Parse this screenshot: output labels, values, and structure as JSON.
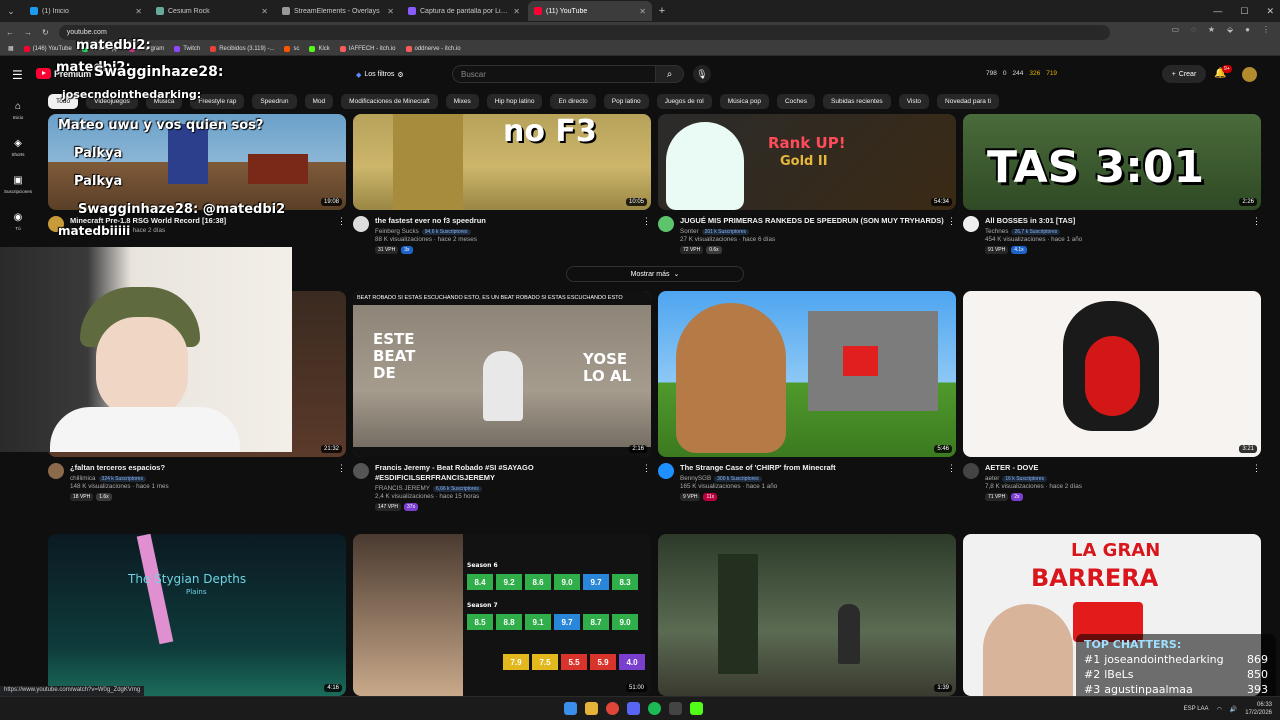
{
  "browser": {
    "tabs": [
      {
        "label": "(1) Inicio",
        "fav": "#1d9bf0",
        "active": false
      },
      {
        "label": "Cesium Rock",
        "fav": "#6a9",
        "active": false
      },
      {
        "label": "StreamElements - Overlays",
        "fav": "#999",
        "active": false
      },
      {
        "label": "Captura de pantalla por Lightshot",
        "fav": "#8a5cff",
        "active": false
      },
      {
        "label": "(11) YouTube",
        "fav": "#ff0033",
        "active": true
      }
    ],
    "url": "youtube.com",
    "bookmarks": [
      {
        "label": "(146) YouTube",
        "color": "#ff0033"
      },
      {
        "label": "WhatsApp",
        "color": "#25d366"
      },
      {
        "label": "Instagram",
        "color": "#c13584"
      },
      {
        "label": "Twitch",
        "color": "#9146ff"
      },
      {
        "label": "Recibidos (3.119) -...",
        "color": "#ea4335"
      },
      {
        "label": "sc",
        "color": "#ff5500"
      },
      {
        "label": "Kick",
        "color": "#53fc18"
      },
      {
        "label": "IAFFECH - itch.io",
        "color": "#fa5c5c"
      },
      {
        "label": "oddnerve - itch.io",
        "color": "#fa5c5c"
      }
    ],
    "status_url": "https://www.youtube.com/watch?v=W0g_ZdgKVmg"
  },
  "header": {
    "logo_text": "Premium",
    "filters_label": "Los filtros",
    "search_placeholder": "Buscar",
    "stats": [
      {
        "text": "798",
        "gold": false
      },
      {
        "text": "0",
        "gold": false
      },
      {
        "text": "244",
        "gold": false
      },
      {
        "text": "326",
        "gold": true
      },
      {
        "text": "719",
        "gold": true
      }
    ],
    "create_label": "Crear",
    "bell_badge": "9+"
  },
  "guide": [
    {
      "icon": "⌂",
      "label": "Inicio",
      "name": "home"
    },
    {
      "icon": "◈",
      "label": "Shorts",
      "name": "shorts"
    },
    {
      "icon": "▣",
      "label": "Suscripciones",
      "name": "subscriptions"
    },
    {
      "icon": "◉",
      "label": "Tú",
      "name": "you"
    }
  ],
  "chips": [
    "Todo",
    "Videojuegos",
    "Música",
    "Freestyle rap",
    "Speedrun",
    "Mod",
    "Modificaciones de Minecraft",
    "Mixes",
    "Hip hop latino",
    "En directo",
    "Pop latino",
    "Juegos de rol",
    "Música pop",
    "Coches",
    "Subidas recientes",
    "Visto",
    "Novedad para ti"
  ],
  "videos": [
    {
      "title": "Minecraft Pre-1.8 RSG World Record [16:38]",
      "channel": "",
      "subs": "",
      "stats": "21 K visualizaciones · hace 2 días",
      "vph": "",
      "mult": "",
      "duration": "19:08",
      "av": "#c79a3a"
    },
    {
      "title": "the fastest ever no f3 speedrun",
      "channel": "Feinberg Sucks",
      "subs": "94,6 k Suscriptores",
      "stats": "88 K visualizaciones · hace 2 meses",
      "vph": "31 VPH",
      "mult": "3x",
      "mult_color": "#1e63c8",
      "duration": "10:05",
      "av": "#ddd"
    },
    {
      "title": "JUGUÉ MIS PRIMERAS RANKEDS DE SPEEDRUN (SON MUY TRYHARDS)",
      "channel": "Sonter",
      "subs": "201 k Suscriptores",
      "stats": "27 K visualizaciones · hace 6 días",
      "vph": "72 VPH",
      "mult": "0.6x",
      "mult_color": "#3a3a3a",
      "duration": "54:34",
      "av": "#5cc46b"
    },
    {
      "title": "All BOSSES in 3:01 [TAS]",
      "channel": "Technes",
      "subs": "26,7 k Suscriptores",
      "stats": "454 K visualizaciones · hace 1 año",
      "vph": "91 VPH",
      "mult": "4.1x",
      "mult_color": "#1e63c8",
      "duration": "2:26",
      "av": "#eee"
    },
    {
      "title": "¿faltan terceros espacios?",
      "channel": "chillimica",
      "subs": "324 k Suscriptores",
      "stats": "148 K visualizaciones · hace 1 mes",
      "vph": "18 VPH",
      "mult": "1.6x",
      "mult_color": "#3a3a3a",
      "duration": "21:32",
      "av": "#8a6a4a"
    },
    {
      "title": "Francis Jeremy - Beat Robado #SI #SAYAGO #ESDIFICILSERFRANCISJEREMY",
      "channel": "FRANCIS JEREMY",
      "subs": "6,66 k Suscriptores",
      "stats": "2,4 K visualizaciones · hace 15 horas",
      "vph": "147 VPH",
      "mult": "37x",
      "mult_color": "#7b3fd0",
      "duration": "2:16",
      "av": "#555"
    },
    {
      "title": "The Strange Case of 'CHIRP' from Minecraft",
      "channel": "BennySGB",
      "subs": "300 k Suscriptores",
      "stats": "165 K visualizaciones · hace 1 año",
      "vph": "9 VPH",
      "mult": "11x",
      "mult_color": "#b8003f",
      "duration": "5:46",
      "av": "#1e90ff"
    },
    {
      "title": "AETER - DOVE",
      "channel": "aeter",
      "subs": "16 k Suscriptores",
      "stats": "7,8 K visualizaciones · hace 2 días",
      "vph": "71 VPH",
      "mult": "2x",
      "mult_color": "#7b3fd0",
      "duration": "3:21",
      "av": "#444"
    },
    {
      "title": "",
      "duration": "4:16"
    },
    {
      "title": "",
      "duration": "51:00"
    },
    {
      "title": "",
      "duration": "1:39"
    },
    {
      "title": "",
      "duration": ""
    }
  ],
  "show_more": "Mostrar más",
  "thumb_text": {
    "v1": "no F3",
    "v2_rank": "Rank UP!",
    "v2_gold": "Gold II",
    "v3": "TAS 3:01",
    "v5_left": "ESTE BEAT DE",
    "v5_right": "YOSE LO AL",
    "v5_banner": "BEAT ROBADO SI ESTAS ESCUCHANDO ESTO, ES UN BEAT ROBADO SI ESTAS ESCUCHANDO ESTO",
    "v8": "The Stygian Depths",
    "v8_sub": "Plains",
    "v11_l1": "LA GRAN",
    "v11_l2": "BARRERA",
    "v9_s6": "Season 6",
    "v9_s7": "Season 7",
    "v9_row1": [
      "8.4",
      "9.2",
      "8.6",
      "9.0",
      "9.7",
      "8.3"
    ],
    "v9_row2": [
      "8.5",
      "8.8",
      "9.1",
      "9.7",
      "8.7",
      "9.0"
    ],
    "v9_row3": [
      "7.9",
      "7.5",
      "5.5",
      "5.9",
      "4.0"
    ]
  },
  "overlay": {
    "chat": [
      {
        "text": "matedbi2:",
        "color": "#ff9b1a"
      },
      {
        "text": "matedbi2:",
        "color": "#ff9b1a"
      },
      {
        "text": "Swagginhaze28:",
        "color": "#c77dff"
      },
      {
        "text": "josecndointhedarking:",
        "color": "#ff4a4a"
      },
      {
        "text": "Mateo uwu y vos quien sos?",
        "color": "#ffffff"
      },
      {
        "text": "Palkya",
        "color": "#b9c9ff"
      },
      {
        "text": "Palkya",
        "color": "#b9c9ff"
      },
      {
        "text": "Swagginhaze28: @matedbi2",
        "color": "#c77dff"
      },
      {
        "text": "matedbiiiii",
        "color": "#ffffff"
      }
    ],
    "top_chatters_title": "TOP CHATTERS:",
    "top_chatters": [
      {
        "rank": "#1",
        "name": "joseandointhedarking",
        "count": "869"
      },
      {
        "rank": "#2",
        "name": "lBeLs",
        "count": "850"
      },
      {
        "rank": "#3",
        "name": "agustinpaalmaa",
        "count": "393"
      }
    ]
  },
  "taskbar": {
    "lang": "ESP LAA",
    "time": "06:33",
    "date": "17/2/2026"
  }
}
